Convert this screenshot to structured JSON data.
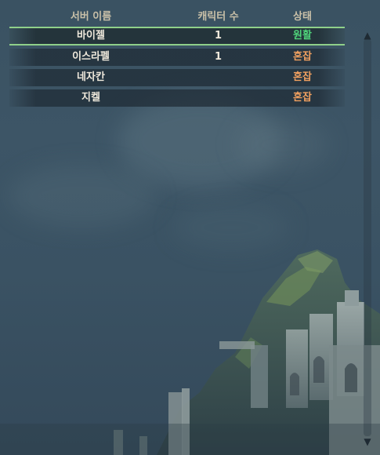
{
  "header": {
    "server_name": "서버 이름",
    "character_count": "캐릭터 수",
    "status": "상태"
  },
  "servers": [
    {
      "name": "바이젤",
      "count": "1",
      "status": "원활",
      "status_type": "smooth",
      "selected": true
    },
    {
      "name": "이스라펠",
      "count": "1",
      "status": "혼잡",
      "status_type": "busy",
      "selected": false
    },
    {
      "name": "네자칸",
      "count": "",
      "status": "혼잡",
      "status_type": "busy",
      "selected": false
    },
    {
      "name": "지켈",
      "count": "",
      "status": "혼잡",
      "status_type": "busy",
      "selected": false
    }
  ],
  "scrollbar": {
    "up_icon": "triangle-up-icon",
    "down_icon": "triangle-down-icon"
  },
  "colors": {
    "status_smooth": "#4fd47a",
    "status_busy": "#f0a060",
    "selected_border": "#8fd08a",
    "header_text": "#c9c0a8"
  }
}
